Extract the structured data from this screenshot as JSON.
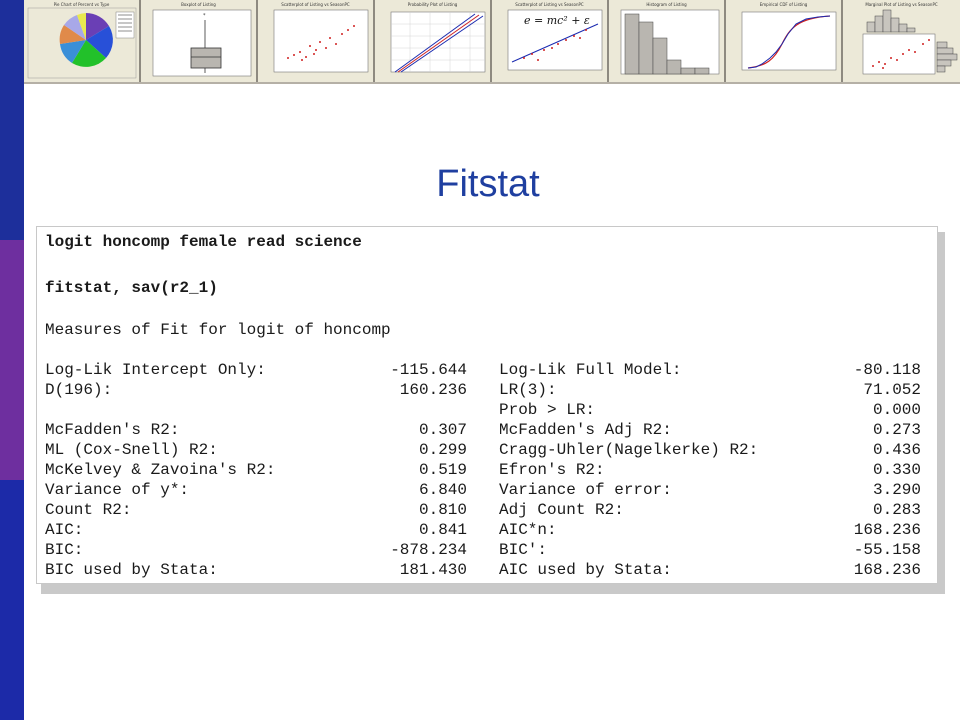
{
  "colors": {
    "sidebar_top": "#1d2f9b",
    "sidebar_middle": "#6e2f9f",
    "sidebar_bottom": "#1c2aa8",
    "title": "#1f3fa0"
  },
  "thumbnails": [
    {
      "title": "Pie Chart of Percent vs Type",
      "kind": "pie"
    },
    {
      "title": "Boxplot of Listing",
      "kind": "boxplot"
    },
    {
      "title": "Scatterplot of Listing vs SeasonPC",
      "kind": "scatter"
    },
    {
      "title": "Probability Plot of Listing",
      "kind": "probability"
    },
    {
      "title": "Scatterplot of Listing vs SeasonPC",
      "kind": "scatter-fit",
      "formula": "e = mc² + ε"
    },
    {
      "title": "Histogram of Listing",
      "kind": "histogram"
    },
    {
      "title": "Empirical CDF of Listing",
      "kind": "cdf"
    },
    {
      "title": "Marginal Plot of Listing vs SeasonPC",
      "kind": "marginal"
    }
  ],
  "slide_title": "Fitstat",
  "stata": {
    "command1": "logit honcomp female read science",
    "command2": "fitstat, sav(r2_1)",
    "heading": "Measures of Fit for logit of honcomp",
    "rows": [
      {
        "l_label": "Log-Lik Intercept Only:",
        "l_value": "-115.644",
        "r_label": "Log-Lik Full Model:",
        "r_value": "-80.118"
      },
      {
        "l_label": "D(196):",
        "l_value": "160.236",
        "r_label": "LR(3):",
        "r_value": "71.052"
      },
      {
        "l_label": "",
        "l_value": "",
        "r_label": "Prob > LR:",
        "r_value": "0.000"
      },
      {
        "l_label": "McFadden's R2:",
        "l_value": "0.307",
        "r_label": "McFadden's Adj R2:",
        "r_value": "0.273"
      },
      {
        "l_label": "ML (Cox-Snell) R2:",
        "l_value": "0.299",
        "r_label": "Cragg-Uhler(Nagelkerke) R2:",
        "r_value": "0.436"
      },
      {
        "l_label": "McKelvey & Zavoina's R2:",
        "l_value": "0.519",
        "r_label": "Efron's R2:",
        "r_value": "0.330"
      },
      {
        "l_label": "Variance of y*:",
        "l_value": "6.840",
        "r_label": "Variance of error:",
        "r_value": "3.290"
      },
      {
        "l_label": "Count R2:",
        "l_value": "0.810",
        "r_label": "Adj Count R2:",
        "r_value": "0.283"
      },
      {
        "l_label": "AIC:",
        "l_value": "0.841",
        "r_label": "AIC*n:",
        "r_value": "168.236"
      },
      {
        "l_label": "BIC:",
        "l_value": "-878.234",
        "r_label": "BIC':",
        "r_value": "-55.158"
      },
      {
        "l_label": "BIC used by Stata:",
        "l_value": "181.430",
        "r_label": "AIC used by Stata:",
        "r_value": "168.236"
      }
    ]
  }
}
